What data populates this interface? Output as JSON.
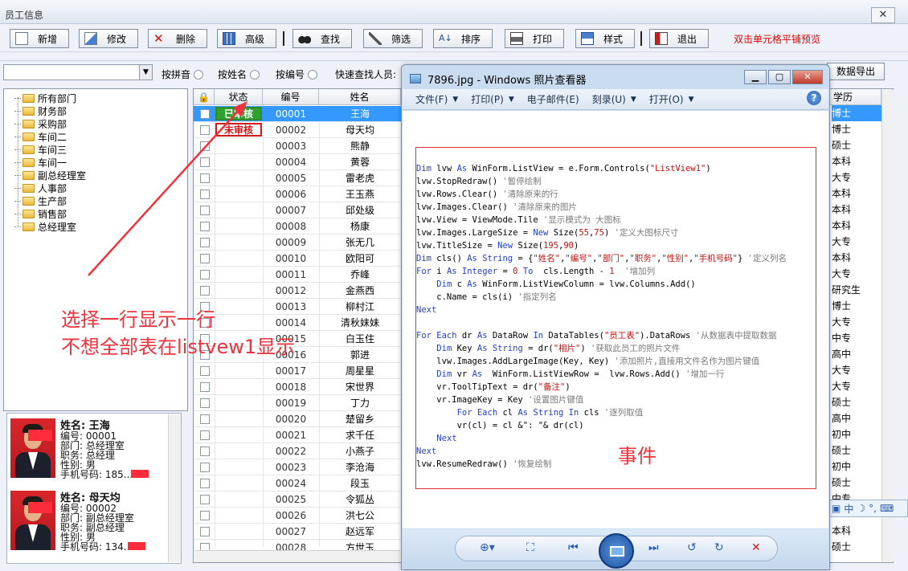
{
  "window": {
    "title": "员工信息",
    "close": "✕"
  },
  "toolbar": {
    "buttons": [
      {
        "label": "新增",
        "icon": "new-document-icon"
      },
      {
        "label": "修改",
        "icon": "edit-icon"
      },
      {
        "label": "删除",
        "icon": "delete-x-icon"
      },
      {
        "label": "高级",
        "icon": "advanced-grid-icon"
      },
      {
        "label": "查找",
        "icon": "binoculars-icon"
      },
      {
        "label": "筛选",
        "icon": "filter-icon"
      },
      {
        "label": "排序",
        "icon": "sort-icon"
      },
      {
        "label": "打印",
        "icon": "printer-icon"
      },
      {
        "label": "样式",
        "icon": "style-icon"
      },
      {
        "label": "退出",
        "icon": "exit-icon"
      }
    ],
    "hint": "双击单元格平铺预览"
  },
  "filter": {
    "radios": [
      "按拼音",
      "按姓名",
      "按编号"
    ],
    "search_label": "快速查找人员:",
    "export_label": "数据导出"
  },
  "tree": {
    "items": [
      "所有部门",
      "财务部",
      "采购部",
      "车间二",
      "车间三",
      "车间一",
      "副总经理室",
      "人事部",
      "生产部",
      "销售部",
      "总经理室"
    ]
  },
  "grid": {
    "headers": [
      "状态",
      "编号",
      "姓名"
    ],
    "rows": [
      {
        "status": "已审核",
        "id": "00001",
        "name": "王海"
      },
      {
        "status": "未审核",
        "id": "00002",
        "name": "母天均"
      },
      {
        "status": "",
        "id": "00003",
        "name": "熊静"
      },
      {
        "status": "",
        "id": "00004",
        "name": "黄蓉"
      },
      {
        "status": "",
        "id": "00005",
        "name": "雷老虎"
      },
      {
        "status": "",
        "id": "00006",
        "name": "王玉燕"
      },
      {
        "status": "",
        "id": "00007",
        "name": "邱处级"
      },
      {
        "status": "",
        "id": "00008",
        "name": "杨康"
      },
      {
        "status": "",
        "id": "00009",
        "name": "张无几"
      },
      {
        "status": "",
        "id": "00010",
        "name": "欧阳可"
      },
      {
        "status": "",
        "id": "00011",
        "name": "乔峰"
      },
      {
        "status": "",
        "id": "00012",
        "name": "金燕西"
      },
      {
        "status": "",
        "id": "00013",
        "name": "柳村江"
      },
      {
        "status": "",
        "id": "00014",
        "name": "清秋妹妹"
      },
      {
        "status": "",
        "id": "00015",
        "name": "白玉住"
      },
      {
        "status": "",
        "id": "00016",
        "name": "郭进"
      },
      {
        "status": "",
        "id": "00017",
        "name": "周星星"
      },
      {
        "status": "",
        "id": "00018",
        "name": "宋世界"
      },
      {
        "status": "",
        "id": "00019",
        "name": "丁力"
      },
      {
        "status": "",
        "id": "00020",
        "name": "楚留乡"
      },
      {
        "status": "",
        "id": "00021",
        "name": "求千任"
      },
      {
        "status": "",
        "id": "00022",
        "name": "小燕子"
      },
      {
        "status": "",
        "id": "00023",
        "name": "李沧海"
      },
      {
        "status": "",
        "id": "00024",
        "name": "段玉"
      },
      {
        "status": "",
        "id": "00025",
        "name": "令狐丛"
      },
      {
        "status": "",
        "id": "00026",
        "name": "洪七公"
      },
      {
        "status": "",
        "id": "00027",
        "name": "赵远军"
      },
      {
        "status": "",
        "id": "00028",
        "name": "方世玉"
      }
    ]
  },
  "right_column": {
    "header": "学历",
    "values": [
      "博士",
      "博士",
      "硕士",
      "本科",
      "大专",
      "本科",
      "本科",
      "本科",
      "大专",
      "本科",
      "大专",
      "研究生",
      "博士",
      "大专",
      "中专",
      "高中",
      "大专",
      "大专",
      "硕士",
      "高中",
      "初中",
      "硕士",
      "初中",
      "硕士",
      "中专",
      "",
      "本科",
      "硕士"
    ]
  },
  "cards": [
    {
      "name": "姓名: 王海",
      "id": "编号: 00001",
      "dept": "部门: 总经理室",
      "job": "职务: 总经理",
      "sex": "性别: 男",
      "phone": "手机号码: 185..."
    },
    {
      "name": "姓名: 母天均",
      "id": "编号: 00002",
      "dept": "部门: 副总经理室",
      "job": "职务: 副总经理",
      "sex": "性别: 男",
      "phone": "手机号码: 134..."
    }
  ],
  "annotation": {
    "line1": "选择一行显示一行",
    "line2": "不想全部表在listvew1显示",
    "event": "事件"
  },
  "viewer": {
    "title": "7896.jpg - Windows 照片查看器",
    "menu": [
      "文件(F)",
      "打印(P)",
      "电子邮件(E)",
      "刻录(U)",
      "打开(O)"
    ],
    "help": "?",
    "buttons": {
      "minimize": "▁",
      "maximize": "▢",
      "close": "✕"
    }
  },
  "ime": {
    "label": "中"
  }
}
